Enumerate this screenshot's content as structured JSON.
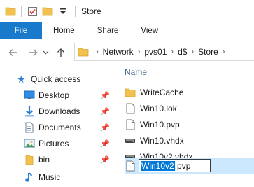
{
  "window": {
    "title": "Store"
  },
  "ribbon": {
    "tabs": [
      "File",
      "Home",
      "Share",
      "View"
    ]
  },
  "address": {
    "crumbs": [
      "Network",
      "pvs01",
      "d$",
      "Store"
    ]
  },
  "nav": {
    "quick_access": "Quick access",
    "items": [
      {
        "label": "Desktop",
        "icon": "desktop-icon",
        "pinned": true
      },
      {
        "label": "Downloads",
        "icon": "downloads-icon",
        "pinned": true
      },
      {
        "label": "Documents",
        "icon": "documents-icon",
        "pinned": true
      },
      {
        "label": "Pictures",
        "icon": "pictures-icon",
        "pinned": true
      },
      {
        "label": "bin",
        "icon": "folder-icon",
        "pinned": true
      },
      {
        "label": "Music",
        "icon": "music-icon",
        "pinned": false
      }
    ]
  },
  "content": {
    "column_header": "Name",
    "files": [
      {
        "name": "WriteCache",
        "icon": "folder-icon"
      },
      {
        "name": "Win10.lok",
        "icon": "document-icon"
      },
      {
        "name": "Win10.pvp",
        "icon": "document-icon"
      },
      {
        "name": "Win10.vhdx",
        "icon": "disk-icon"
      },
      {
        "name": "Win10v2.vhdx",
        "icon": "disk-icon"
      }
    ],
    "rename": {
      "selected_part": "Win10v2",
      "rest_part": ".pvp",
      "icon": "document-icon"
    }
  },
  "colors": {
    "file_tab": "#1979ca",
    "folder": "#f2c14e",
    "selection": "#0078d7"
  }
}
